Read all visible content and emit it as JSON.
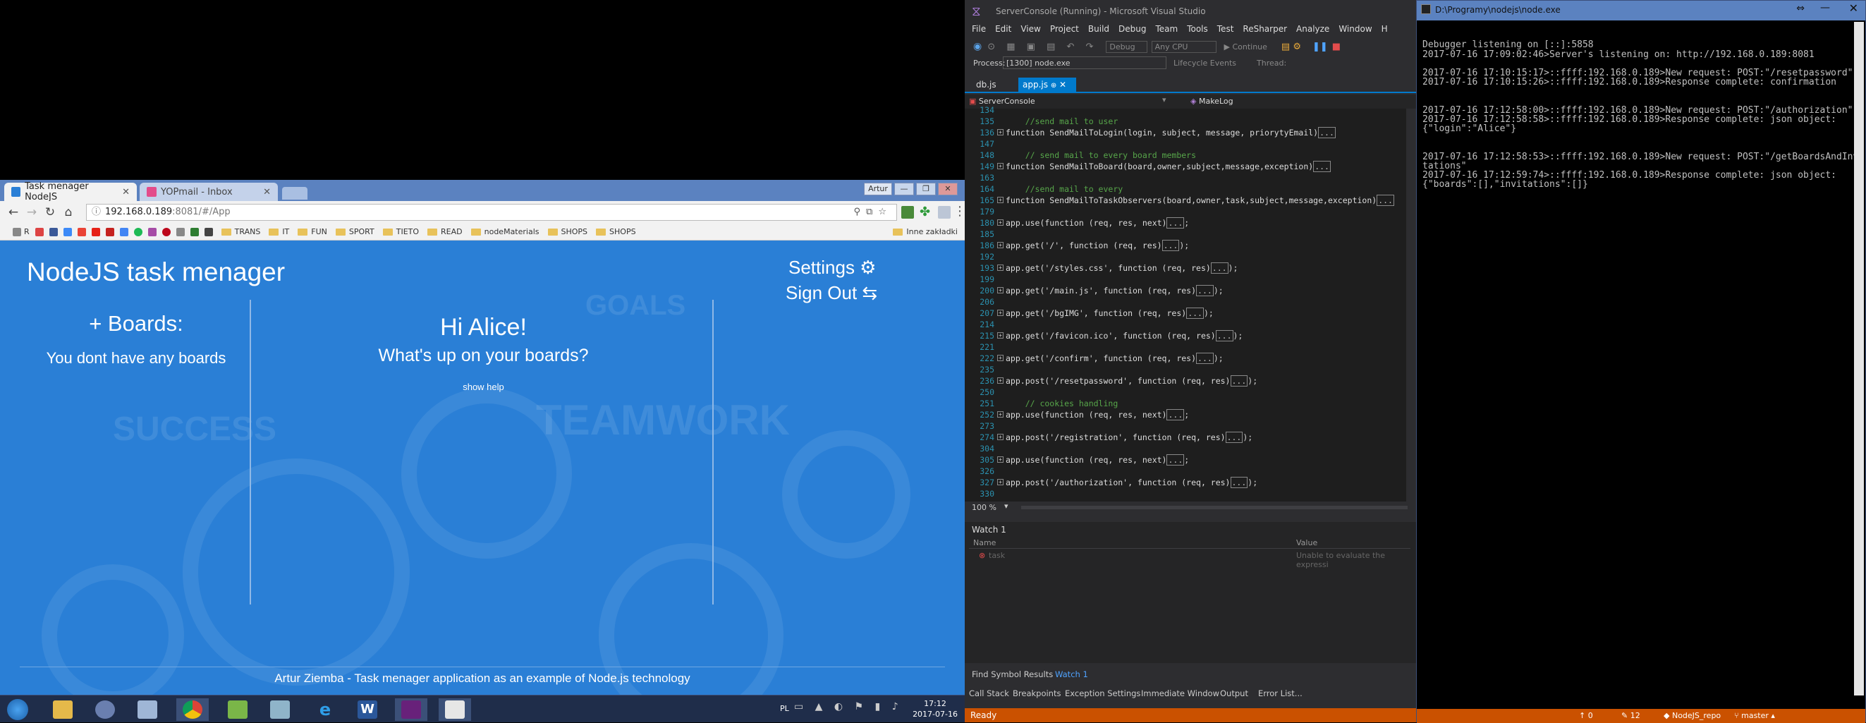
{
  "chrome": {
    "tabs": [
      {
        "label": "Task menager NodeJS",
        "active": true
      },
      {
        "label": "YOPmail - Inbox",
        "active": false
      }
    ],
    "window_badge": "Artur",
    "url": "192.168.0.189",
    "url_rest": ":8081/#/App",
    "bookmarks": [
      "TRANS",
      "IT",
      "FUN",
      "SPORT",
      "TIETO",
      "READ",
      "nodeMaterials",
      "SHOPS",
      "SHOPS"
    ],
    "other_bookmarks": "Inne zakładki"
  },
  "app": {
    "title": "NodeJS task menager",
    "settings": "Settings ⚙",
    "signout": "Sign Out ⇆",
    "boards_heading": "+ Boards:",
    "no_boards": "You dont have any boards",
    "greeting": "Hi Alice!",
    "subtitle": "What's up on your boards?",
    "show_help": "show help",
    "footer": "Artur Ziemba - Task menager application as an example of Node.js technology",
    "bg_words": [
      "SUCCESS",
      "GOALS",
      "TEAMWORK"
    ]
  },
  "taskbar": {
    "lang": "PL",
    "time": "17:12",
    "date": "2017-07-16"
  },
  "vs": {
    "title": "ServerConsole (Running) - Microsoft Visual Studio",
    "menu": [
      "File",
      "Edit",
      "View",
      "Project",
      "Build",
      "Debug",
      "Team",
      "Tools",
      "Test",
      "ReSharper",
      "Analyze",
      "Window",
      "H"
    ],
    "toolbar": {
      "config": "Debug",
      "platform": "Any CPU",
      "continue": "Continue"
    },
    "process_label": "Process:",
    "process_value": "[1300] node.exe",
    "lifecycle": "Lifecycle Events",
    "thread": "Thread:",
    "tabs": [
      {
        "label": "db.js",
        "active": false
      },
      {
        "label": "app.js",
        "active": true
      }
    ],
    "nav_left": "ServerConsole",
    "nav_right": "MakeLog",
    "code": [
      {
        "n": "134",
        "t": ""
      },
      {
        "n": "135",
        "t": "    //send mail to user",
        "c": "cm"
      },
      {
        "n": "136",
        "f": true,
        "t": "function SendMailToLogin(login, subject, message, priorytyEmail)",
        "x": true
      },
      {
        "n": "147",
        "t": ""
      },
      {
        "n": "148",
        "t": "    // send mail to every board members",
        "c": "cm"
      },
      {
        "n": "149",
        "f": true,
        "t": "function SendMailToBoard(board,owner,subject,message,exception)",
        "x": true
      },
      {
        "n": "163",
        "t": ""
      },
      {
        "n": "164",
        "t": "    //send mail to every",
        "c": "cm"
      },
      {
        "n": "165",
        "f": true,
        "t": "function SendMailToTaskObservers(board,owner,task,subject,message,exception)",
        "x": true
      },
      {
        "n": "179",
        "t": ""
      },
      {
        "n": "180",
        "f": true,
        "t": "app.use(function (req, res, next)",
        "x": true,
        "e": ";"
      },
      {
        "n": "185",
        "t": ""
      },
      {
        "n": "186",
        "f": true,
        "t": "app.get('/', function (req, res)",
        "x": true,
        "e": ");"
      },
      {
        "n": "192",
        "t": ""
      },
      {
        "n": "193",
        "f": true,
        "t": "app.get('/styles.css', function (req, res)",
        "x": true,
        "e": ");"
      },
      {
        "n": "199",
        "t": ""
      },
      {
        "n": "200",
        "f": true,
        "t": "app.get('/main.js', function (req, res)",
        "x": true,
        "e": ");"
      },
      {
        "n": "206",
        "t": ""
      },
      {
        "n": "207",
        "f": true,
        "t": "app.get('/bgIMG', function (req, res)",
        "x": true,
        "e": ");"
      },
      {
        "n": "214",
        "t": ""
      },
      {
        "n": "215",
        "f": true,
        "t": "app.get('/favicon.ico', function (req, res)",
        "x": true,
        "e": ");"
      },
      {
        "n": "221",
        "t": ""
      },
      {
        "n": "222",
        "f": true,
        "t": "app.get('/confirm', function (req, res)",
        "x": true,
        "e": ");"
      },
      {
        "n": "235",
        "t": ""
      },
      {
        "n": "236",
        "f": true,
        "t": "app.post('/resetpassword', function (req, res)",
        "x": true,
        "e": ");"
      },
      {
        "n": "250",
        "t": ""
      },
      {
        "n": "251",
        "t": "    // cookies handling",
        "c": "cm"
      },
      {
        "n": "252",
        "f": true,
        "t": "app.use(function (req, res, next)",
        "x": true,
        "e": ";"
      },
      {
        "n": "273",
        "t": ""
      },
      {
        "n": "274",
        "f": true,
        "t": "app.post('/registration', function (req, res)",
        "x": true,
        "e": ");"
      },
      {
        "n": "304",
        "t": ""
      },
      {
        "n": "305",
        "f": true,
        "t": "app.use(function (req, res, next)",
        "x": true,
        "e": ";"
      },
      {
        "n": "326",
        "t": ""
      },
      {
        "n": "327",
        "f": true,
        "t": "app.post('/authorization', function (req, res)",
        "x": true,
        "e": ");"
      },
      {
        "n": "330",
        "t": ""
      }
    ],
    "zoom": "100 %",
    "watch": {
      "title": "Watch 1",
      "col_name": "Name",
      "col_value": "Value",
      "row_name": "task",
      "row_value": "Unable to evaluate the expressi"
    },
    "bottom_tabs1": [
      "Find Symbol Results",
      "Watch 1"
    ],
    "bottom_tabs2": [
      "Call Stack",
      "Breakpoints",
      "Exception Settings",
      "Immediate Window",
      "Output",
      "Error List..."
    ],
    "status": "Ready",
    "status_right": [
      "0",
      "12",
      "NodeJS_repo",
      "master"
    ]
  },
  "console": {
    "title": "D:\\Programy\\nodejs\\node.exe",
    "lines": [
      "Debugger listening on [::]:5858",
      "2017-07-16 17:09:02:46>Server's listening on: http://192.168.0.189:8081",
      "",
      "2017-07-16 17:10:15:17>::ffff:192.168.0.189>New request: POST:\"/resetpassword\"",
      "2017-07-16 17:10:15:26>::ffff:192.168.0.189>Response complete: confirmation",
      "",
      "",
      "2017-07-16 17:12:58:00>::ffff:192.168.0.189>New request: POST:\"/authorization\"",
      "2017-07-16 17:12:58:58>::ffff:192.168.0.189>Response complete: json object:",
      "{\"login\":\"Alice\"}",
      "",
      "",
      "2017-07-16 17:12:58:53>::ffff:192.168.0.189>New request: POST:\"/getBoardsAndInvi",
      "tations\"",
      "2017-07-16 17:12:59:74>::ffff:192.168.0.189>Response complete: json object:",
      "{\"boards\":[],\"invitations\":[]}"
    ]
  },
  "colors": {
    "app_blue": "#2a7fd6",
    "vs_accent": "#007acc",
    "status_orange": "#ca5100"
  }
}
